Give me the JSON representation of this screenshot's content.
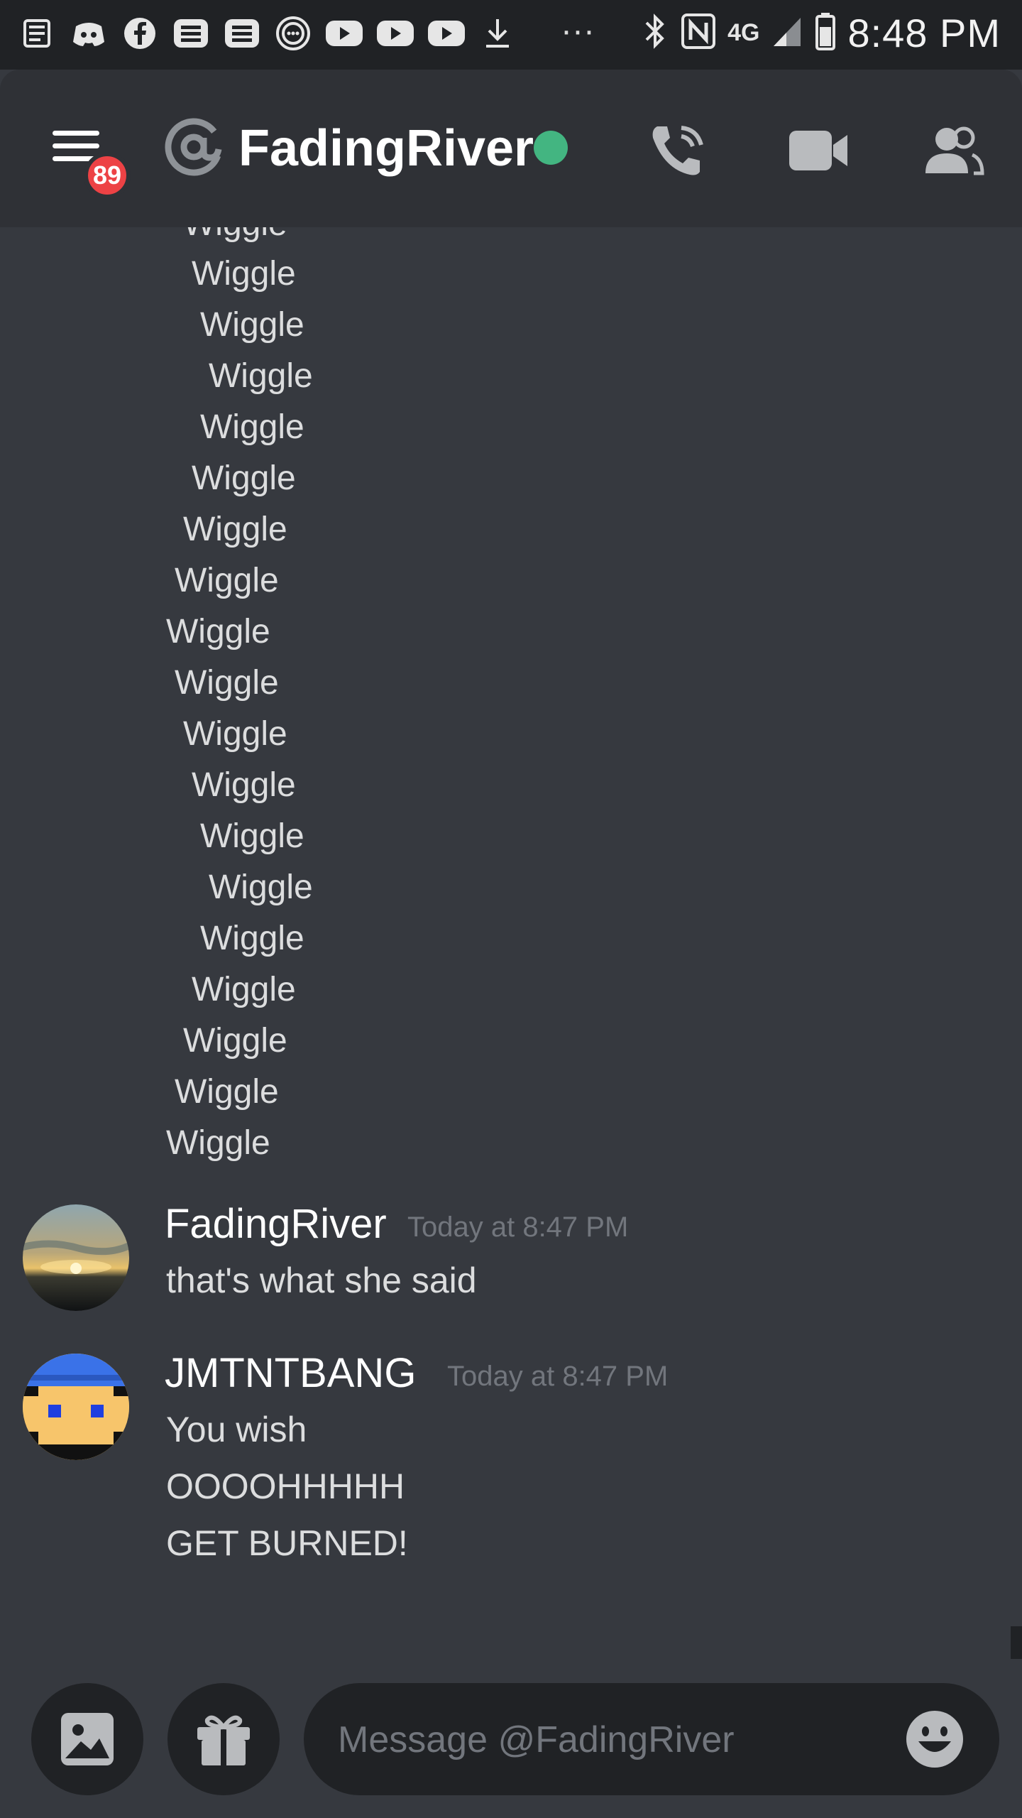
{
  "status_bar": {
    "time": "8:48 PM",
    "network": "4G",
    "app_icons": [
      "news-icon",
      "discord-icon",
      "facebook-icon",
      "list-app-icon",
      "list-app-icon",
      "messenger-icon",
      "youtube-icon",
      "youtube-icon",
      "youtube-icon",
      "download-icon"
    ],
    "more": "···"
  },
  "header": {
    "unread_badge": "89",
    "dm_title": "FadingRiver",
    "status": "online",
    "colors": {
      "online": "#43b581",
      "badge": "#ed4245"
    }
  },
  "wiggle_lines": [
    "Wiggle",
    "Wiggle",
    "Wiggle",
    "Wiggle",
    "Wiggle",
    "Wiggle",
    "Wiggle",
    "Wiggle",
    "Wiggle",
    "Wiggle",
    "Wiggle",
    "Wiggle",
    "Wiggle",
    "Wiggle",
    "Wiggle",
    "Wiggle",
    "Wiggle",
    "Wiggle",
    "Wiggle"
  ],
  "messages": [
    {
      "author": "FadingRiver",
      "timestamp": "Today at 8:47 PM",
      "lines": [
        "that's what she said"
      ]
    },
    {
      "author": "JMTNTBANG",
      "timestamp": "Today at 8:47 PM",
      "lines": [
        "You wish",
        "OOOOHHHHH",
        "GET BURNED!"
      ]
    }
  ],
  "composer": {
    "placeholder": "Message @FadingRiver"
  }
}
